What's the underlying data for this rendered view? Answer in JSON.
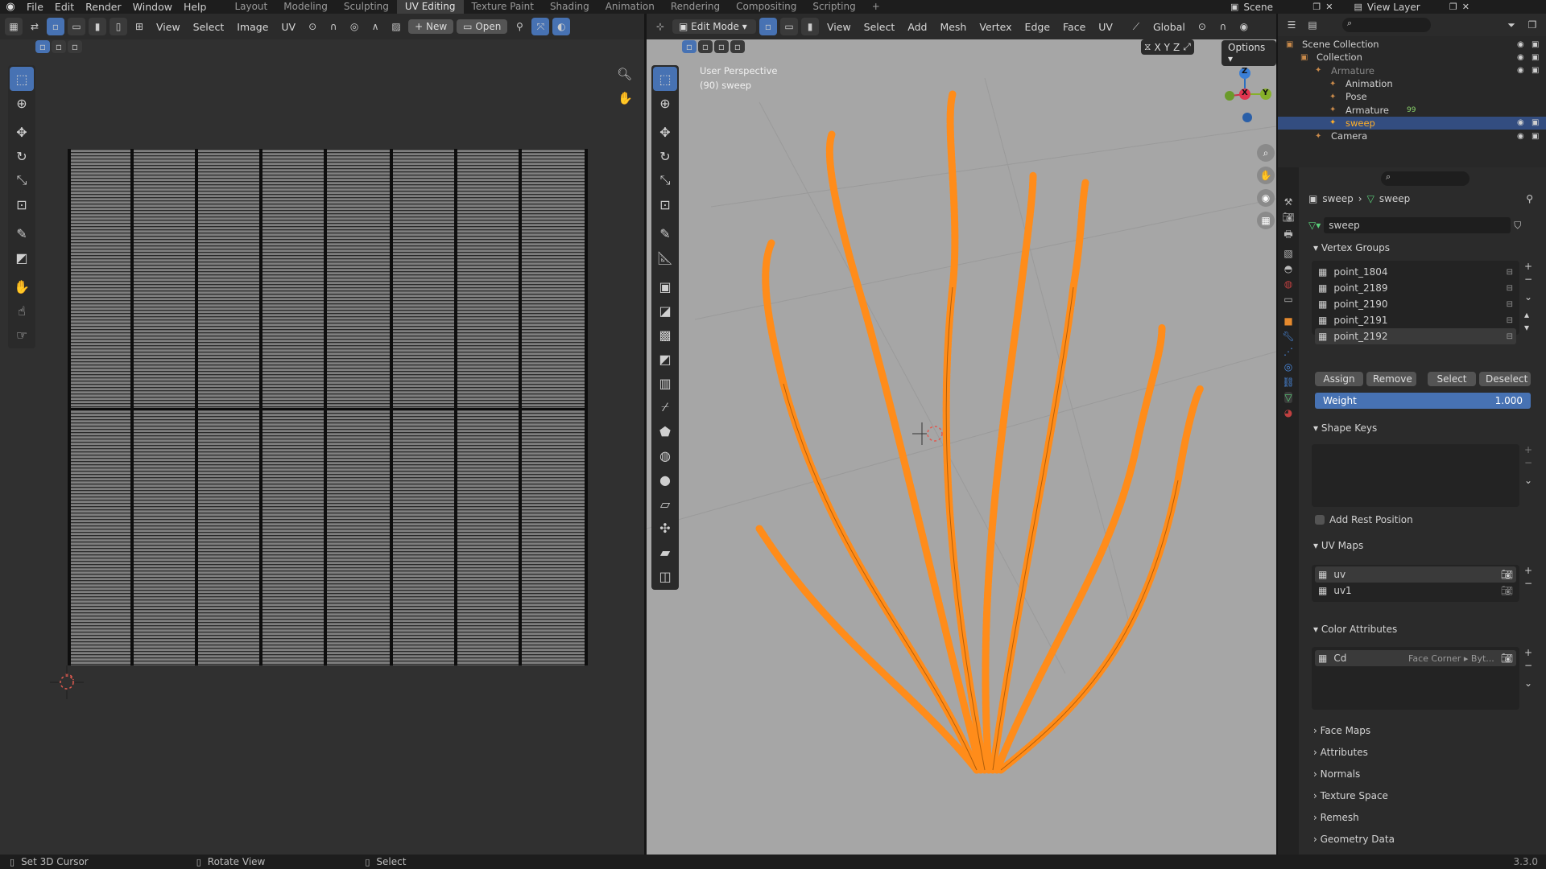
{
  "top_menu": [
    "File",
    "Edit",
    "Render",
    "Window",
    "Help"
  ],
  "workspaces": [
    "Layout",
    "Modeling",
    "Sculpting",
    "UV Editing",
    "Texture Paint",
    "Shading",
    "Animation",
    "Rendering",
    "Compositing",
    "Scripting"
  ],
  "active_workspace": "UV Editing",
  "scene_label": "Scene",
  "view_layer_label": "View Layer",
  "uv_header": {
    "view": "View",
    "select": "Select",
    "image": "Image",
    "uv": "UV",
    "new": "New",
    "open": "Open"
  },
  "viewport_header": {
    "mode": "Edit Mode",
    "view": "View",
    "select": "Select",
    "add": "Add",
    "mesh": "Mesh",
    "vertex": "Vertex",
    "edge": "Edge",
    "face": "Face",
    "uv": "UV",
    "orientation": "Global",
    "options": "Options",
    "axes": [
      "X",
      "Y",
      "Z"
    ]
  },
  "viewport_overlay": {
    "line1": "User Perspective",
    "line2": "(90) sweep"
  },
  "gizmo": {
    "z": "Z",
    "x": "X",
    "y": "Y"
  },
  "outliner": {
    "items": [
      {
        "label": "Scene Collection",
        "indent": 0
      },
      {
        "label": "Collection",
        "indent": 1
      },
      {
        "label": "Armature",
        "indent": 2
      },
      {
        "label": "Animation",
        "indent": 3
      },
      {
        "label": "Pose",
        "indent": 3
      },
      {
        "label": "Armature",
        "indent": 3,
        "badge": "99"
      },
      {
        "label": "sweep",
        "indent": 3,
        "selected": true
      },
      {
        "label": "Camera",
        "indent": 2
      }
    ]
  },
  "properties": {
    "breadcrumb": [
      "sweep",
      "sweep"
    ],
    "mesh_name": "sweep",
    "vertex_groups": {
      "title": "Vertex Groups",
      "items": [
        "point_1804",
        "point_2189",
        "point_2190",
        "point_2191",
        "point_2192"
      ],
      "buttons": [
        "Assign",
        "Remove",
        "Select",
        "Deselect"
      ],
      "weight_label": "Weight",
      "weight_value": "1.000"
    },
    "shape_keys": {
      "title": "Shape Keys",
      "add_rest": "Add Rest Position"
    },
    "uv_maps": {
      "title": "UV Maps",
      "items": [
        "uv",
        "uv1"
      ]
    },
    "color_attributes": {
      "title": "Color Attributes",
      "item": "Cd",
      "domain": "Face Corner ▸ Byt..."
    },
    "collapsed": [
      "Face Maps",
      "Attributes",
      "Normals",
      "Texture Space",
      "Remesh",
      "Geometry Data"
    ]
  },
  "status": {
    "left": "Set 3D Cursor",
    "middle": "Rotate View",
    "right": "Select",
    "version": "3.3.0"
  },
  "colors": {
    "accent": "#4772b3",
    "mesh": "#ff8c1a",
    "selected_text": "#ffaf29",
    "viewport_bg": "#a6a6a6"
  }
}
